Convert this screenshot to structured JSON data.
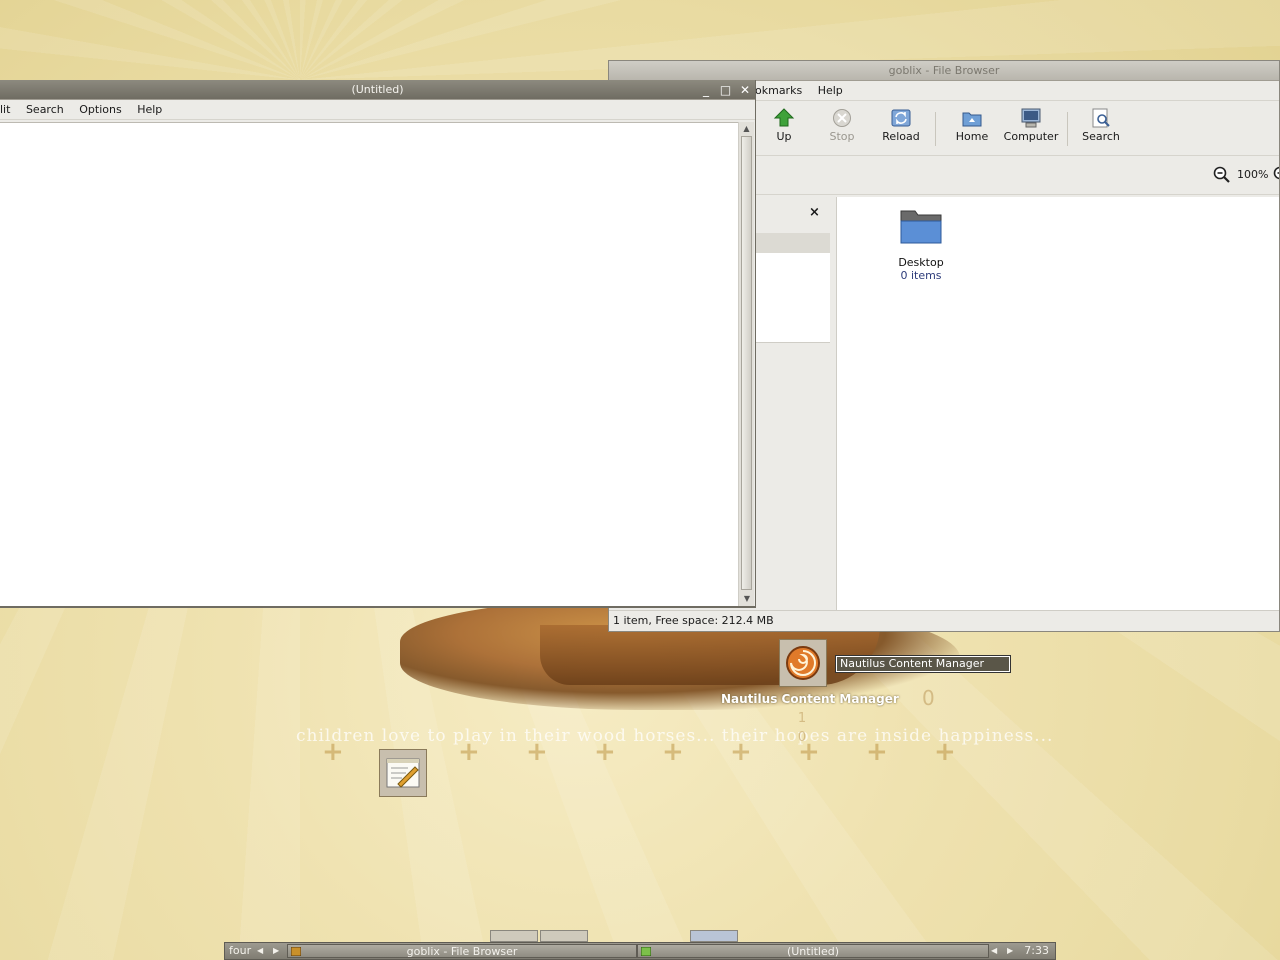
{
  "desktop": {
    "quote": "children love to play in their wood horses... their hopes are inside happiness...",
    "digits": [
      "0",
      "1",
      "0"
    ],
    "digit0": "0",
    "icons": [
      {
        "label": "Nautilus Content Manager",
        "tooltip": "Nautilus Content Manager",
        "icon": "nautilus-shell-icon"
      },
      {
        "label": "",
        "icon": "text-editor-icon"
      }
    ]
  },
  "file_browser": {
    "title": "goblix - File Browser",
    "menu": [
      "Bookmarks",
      "Help"
    ],
    "menu_visible": [
      "okmarks",
      "Help"
    ],
    "toolbar": [
      {
        "label": "Up",
        "icon": "up-arrow-icon",
        "enabled": true
      },
      {
        "label": "Stop",
        "icon": "stop-icon",
        "enabled": false
      },
      {
        "label": "Reload",
        "icon": "reload-icon",
        "enabled": true
      },
      {
        "label": "Home",
        "icon": "home-folder-icon",
        "enabled": true
      },
      {
        "label": "Computer",
        "icon": "computer-icon",
        "enabled": true
      },
      {
        "label": "Search",
        "icon": "search-icon",
        "enabled": true
      }
    ],
    "zoom": "100%",
    "side_close": "×",
    "items": [
      {
        "name": "Desktop",
        "info": "0 items",
        "icon": "folder-icon"
      }
    ],
    "status": "1 item, Free space: 212.4 MB"
  },
  "editor": {
    "title": "(Untitled)",
    "menu": [
      "lit",
      "Search",
      "Options",
      "Help"
    ],
    "wm_buttons": {
      "minimize": "_",
      "maximize": "□",
      "close": "✕"
    }
  },
  "panel": {
    "workspace": "four",
    "tasks": [
      {
        "label": "goblix - File Browser",
        "icon": "file-browser-icon"
      },
      {
        "label": "(Untitled)",
        "icon": "text-editor-icon"
      }
    ],
    "clock": "7:33"
  },
  "colors": {
    "titlebar_active": "#7d7a70",
    "desktop": "#efe2b0",
    "tooltip_bg": "#5a5648"
  }
}
